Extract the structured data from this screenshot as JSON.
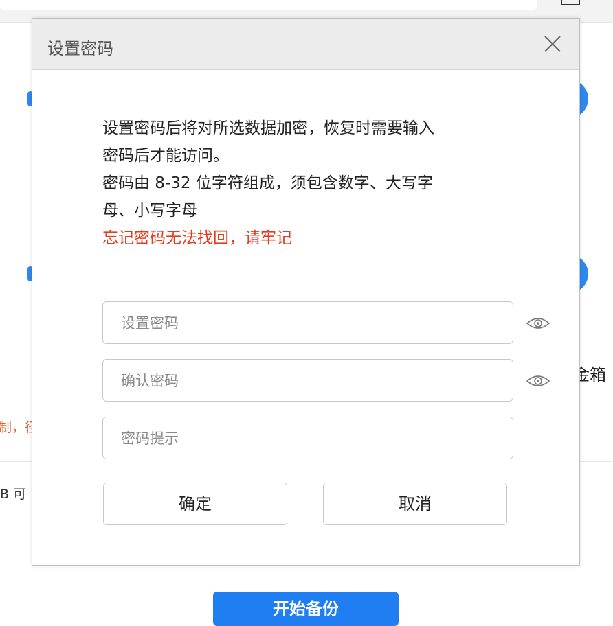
{
  "background": {
    "side_text_right": "金箱",
    "side_text_left_orange": "制，径",
    "side_text_left_small": "B  可",
    "start_button_label": "开始备份"
  },
  "dialog": {
    "title": "设置密码",
    "description_lines": [
      "设置密码后将对所选数据加密，恢复时需要输入",
      "密码后才能访问。",
      "密码由 8-32 位字符组成，须包含数字、大写字",
      "母、小写字母"
    ],
    "warning": "忘记密码无法找回，请牢记",
    "fields": {
      "password": {
        "placeholder": "设置密码",
        "value": ""
      },
      "confirm": {
        "placeholder": "确认密码",
        "value": ""
      },
      "hint": {
        "placeholder": "密码提示",
        "value": ""
      }
    },
    "confirm_label": "确定",
    "cancel_label": "取消"
  },
  "icons": {
    "close": "close-icon",
    "eye": "eye-icon"
  },
  "colors": {
    "warning": "#e53c1c",
    "accent": "#2f88f0",
    "header_bg": "#ececec"
  }
}
